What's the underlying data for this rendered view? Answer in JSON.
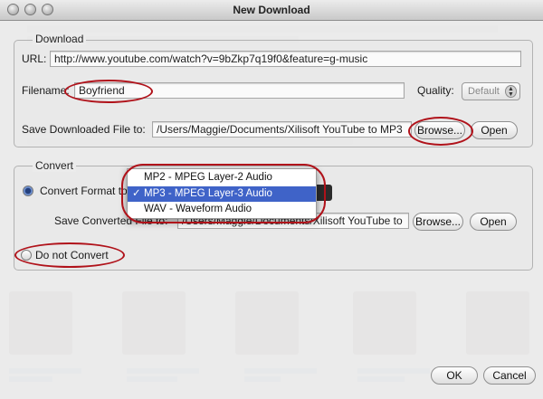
{
  "window": {
    "title": "New Download"
  },
  "download": {
    "group_title": "Download",
    "url_label": "URL:",
    "url_value": "http://www.youtube.com/watch?v=9bZkp7q19f0&feature=g-music",
    "filename_label": "Filename:",
    "filename_value": "Boyfriend",
    "quality_label": "Quality:",
    "quality_value": "Default",
    "save_label": "Save Downloaded File to:",
    "save_path": "/Users/Maggie/Documents/Xilisoft YouTube to MP3",
    "browse_label": "Browse...",
    "open_label": "Open"
  },
  "convert": {
    "group_title": "Convert",
    "format_label": "Convert Format to",
    "format_options": [
      "MP2 - MPEG Layer-2 Audio",
      "MP3 - MPEG Layer-3 Audio",
      "WAV - Waveform Audio"
    ],
    "format_selected": "MP3 - MPEG Layer-3 Audio",
    "check_mark": "✓",
    "save_label": "Save Converted File to:",
    "save_path": "/Users/Maggie/Documents/Xilisoft YouTube to",
    "browse_label": "Browse...",
    "open_label": "Open",
    "no_convert_label": "Do not Convert"
  },
  "footer": {
    "ok_label": "OK",
    "cancel_label": "Cancel"
  },
  "colors": {
    "highlight": "#3f63c8",
    "annotation_ring": "#b0121a"
  }
}
